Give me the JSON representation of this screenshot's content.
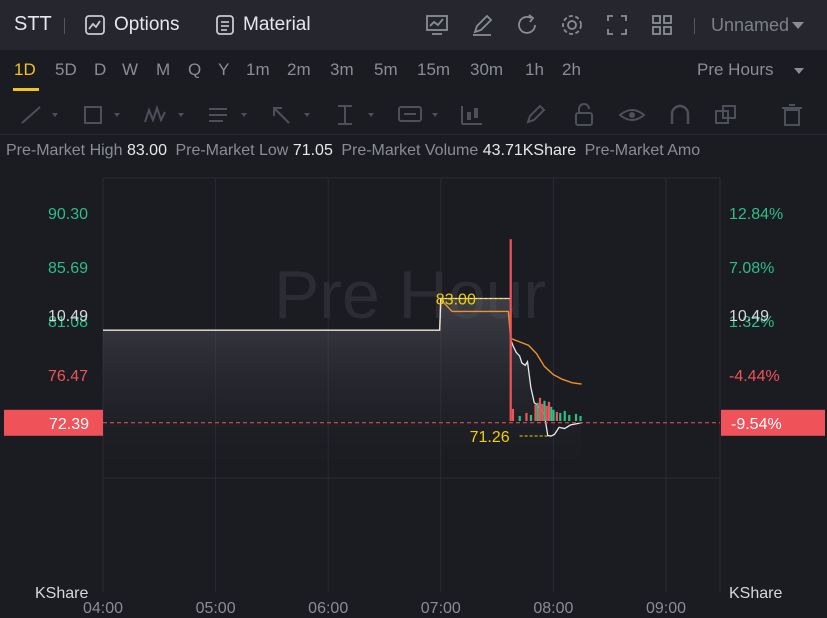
{
  "header": {
    "symbol": "STT",
    "options_label": "Options",
    "material_label": "Material",
    "layout_name": "Unnamed",
    "icons": [
      "indicator-icon",
      "edit-icon",
      "refresh-icon",
      "settings-icon",
      "fullscreen-icon",
      "grid-layout-icon"
    ]
  },
  "intervals": [
    "1D",
    "5D",
    "D",
    "W",
    "M",
    "Q",
    "Y",
    "1m",
    "2m",
    "3m",
    "5m",
    "15m",
    "30m",
    "1h",
    "2h"
  ],
  "active_interval": "1D",
  "session_select": "Pre Hours",
  "drawing_tools": [
    "line-tool-icon",
    "rectangle-tool-icon",
    "pattern-tool-icon",
    "text-tool-icon",
    "arrow-tool-icon",
    "measure-tool-icon",
    "note-tool-icon",
    "chart-pattern-icon",
    "brush-icon",
    "lock-icon",
    "eye-icon",
    "magnet-icon",
    "copy-icon",
    "trash-icon"
  ],
  "info": {
    "high_label": "Pre-Market High",
    "high_value": "83.00",
    "low_label": "Pre-Market Low",
    "low_value": "71.05",
    "volume_label": "Pre-Market Volume",
    "volume_value": "43.71KShare",
    "amount_label": "Pre-Market Amo"
  },
  "chart_data": {
    "type": "line",
    "watermark": "Pre Hour",
    "x_ticks": [
      "04:00",
      "05:00",
      "06:00",
      "07:00",
      "08:00",
      "09:00"
    ],
    "y_ticks_left": [
      {
        "label": "90.30",
        "value": 90.3,
        "color": "#2ebd85"
      },
      {
        "label": "85.69",
        "value": 85.69,
        "color": "#2ebd85"
      },
      {
        "label": "81.08",
        "value": 81.08,
        "color": "#2ebd85"
      },
      {
        "label": "76.47",
        "value": 76.47,
        "color": "#f0525a"
      }
    ],
    "y_ticks_right": [
      {
        "label": "12.84%",
        "value": 90.3,
        "color": "#2ebd85"
      },
      {
        "label": "7.08%",
        "value": 85.69,
        "color": "#2ebd85"
      },
      {
        "label": "1.32%",
        "value": 81.08,
        "color": "#2ebd85"
      },
      {
        "label": "-4.44%",
        "value": 76.47,
        "color": "#f0525a"
      }
    ],
    "current_price": {
      "label": "72.39",
      "pct": "-9.54%",
      "value": 72.39,
      "color": "#f0525a"
    },
    "high_marker": {
      "label": "83.00",
      "value": 83.0,
      "time": 7.08
    },
    "low_marker": {
      "label": "71.26",
      "value": 71.26,
      "time": 7.95
    },
    "price_series": [
      [
        4.0,
        80.3
      ],
      [
        6.99,
        80.3
      ],
      [
        6.99,
        80.3
      ],
      [
        7.0,
        83.0
      ],
      [
        7.62,
        83.0
      ],
      [
        7.62,
        79.5
      ],
      [
        7.64,
        79.0
      ],
      [
        7.67,
        78.4
      ],
      [
        7.7,
        78.1
      ],
      [
        7.72,
        77.5
      ],
      [
        7.75,
        77.3
      ],
      [
        7.77,
        77.6
      ],
      [
        7.8,
        75.4
      ],
      [
        7.83,
        74.1
      ],
      [
        7.86,
        73.9
      ],
      [
        7.89,
        73.4
      ],
      [
        7.92,
        73.1
      ],
      [
        7.95,
        71.3
      ],
      [
        7.98,
        71.26
      ],
      [
        8.01,
        71.4
      ],
      [
        8.05,
        72.0
      ],
      [
        8.1,
        71.9
      ],
      [
        8.15,
        72.2
      ],
      [
        8.2,
        72.3
      ],
      [
        8.25,
        72.39
      ]
    ],
    "avg_series": [
      [
        4.0,
        80.3
      ],
      [
        6.99,
        80.3
      ],
      [
        7.0,
        82.9
      ],
      [
        7.1,
        81.9
      ],
      [
        7.6,
        81.9
      ],
      [
        7.62,
        79.6
      ],
      [
        7.7,
        79.3
      ],
      [
        7.78,
        79.0
      ],
      [
        7.85,
        78.3
      ],
      [
        7.92,
        77.2
      ],
      [
        8.0,
        76.5
      ],
      [
        8.08,
        76.1
      ],
      [
        8.17,
        75.8
      ],
      [
        8.25,
        75.7
      ]
    ],
    "volume_axis": {
      "tick_label": "10.49",
      "tick_value": 10.49,
      "unit": "KShare",
      "max": 19.0
    },
    "volume": [
      {
        "t": 7.62,
        "v": 18.0,
        "up": false
      },
      {
        "t": 7.64,
        "v": 1.2,
        "up": false
      },
      {
        "t": 7.7,
        "v": 0.5,
        "up": true
      },
      {
        "t": 7.76,
        "v": 0.8,
        "up": false
      },
      {
        "t": 7.8,
        "v": 0.6,
        "up": true
      },
      {
        "t": 7.84,
        "v": 1.6,
        "up": false
      },
      {
        "t": 7.86,
        "v": 1.8,
        "up": true
      },
      {
        "t": 7.88,
        "v": 2.3,
        "up": false
      },
      {
        "t": 7.9,
        "v": 1.7,
        "up": false
      },
      {
        "t": 7.92,
        "v": 2.0,
        "up": true
      },
      {
        "t": 7.94,
        "v": 1.5,
        "up": false
      },
      {
        "t": 7.96,
        "v": 1.9,
        "up": false
      },
      {
        "t": 7.98,
        "v": 1.4,
        "up": true
      },
      {
        "t": 8.0,
        "v": 1.1,
        "up": true
      },
      {
        "t": 8.03,
        "v": 0.9,
        "up": false
      },
      {
        "t": 8.06,
        "v": 0.8,
        "up": true
      },
      {
        "t": 8.1,
        "v": 1.0,
        "up": true
      },
      {
        "t": 8.14,
        "v": 0.6,
        "up": true
      },
      {
        "t": 8.2,
        "v": 0.7,
        "up": true
      },
      {
        "t": 8.24,
        "v": 0.5,
        "up": true
      }
    ],
    "colors": {
      "price_line": "#e8e8ec",
      "avg_line": "#f0922a",
      "marker": "#f0d000",
      "up": "#2ebd85",
      "down": "#f0525a",
      "grid": "#2a2b32"
    }
  }
}
